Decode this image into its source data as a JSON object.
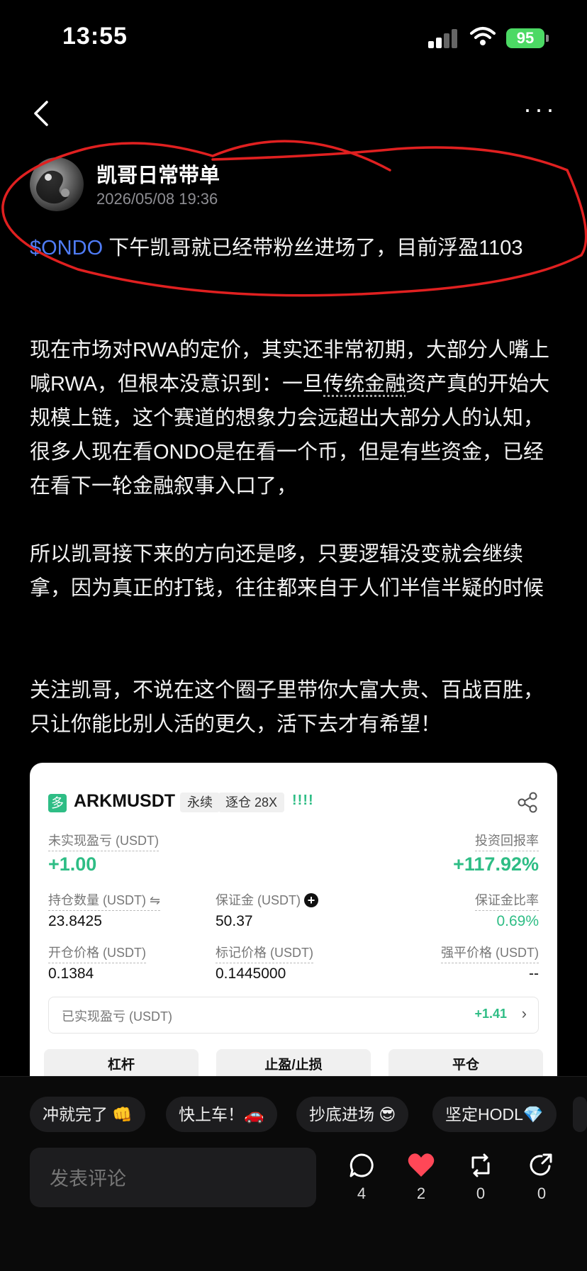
{
  "status_bar": {
    "time": "13:55",
    "battery": "95"
  },
  "post": {
    "author": "凯哥日常带单",
    "date": "2026/05/08 19:36",
    "ticker": "$ONDO",
    "first_line": " 下午凯哥就已经带粉丝进场了，目前浮盈1103",
    "para1_a": "现在市场对RWA的定价，其实还非常初期，大部分人嘴上喊RWA，但根本没意识到：一旦",
    "para1_u": "传统金融",
    "para1_b": "资产真的开始大规模上链，这个赛道的想象力会远超出大部分人的认知，很多人现在看ONDO是在看一个币，但是有些资金，已经在看下一轮金融叙事入口了，",
    "para2": "所以凯哥接下来的方向还是哆，只要逻辑没变就会继续拿，因为真正的打钱，往往都来自于人们半信半疑的时候",
    "para3": "关注凯哥，不说在这个圈子里带你大富大贵、百战百胜，只让你能比别人活的更久，活下去才有希望！"
  },
  "card": {
    "badge": "多",
    "symbol": "ARKMUSDT",
    "tag1": "永续",
    "tag2": "逐仓 28X",
    "bars": "!!!!",
    "unrealized_label": "未实现盈亏 (USDT)",
    "unrealized_value": "+1.00",
    "roi_label": "投资回报率",
    "roi_value": "+117.92%",
    "qty_label": "持仓数量 (USDT) ⇋",
    "qty_value": "23.8425",
    "margin_label": "保证金 (USDT)",
    "margin_value": "50.37",
    "margin_ratio_label": "保证金比率",
    "margin_ratio_value": "0.69%",
    "open_price_label": "开仓价格 (USDT)",
    "open_price_value": "0.1384",
    "mark_price_label": "标记价格 (USDT)",
    "mark_price_value": "0.1445000",
    "liq_price_label": "强平价格 (USDT)",
    "liq_price_value": "--",
    "realized_label": "已实现盈亏 (USDT)",
    "realized_value": "+1.41",
    "buttons": [
      "杠杆",
      "止盈/止损",
      "平仓"
    ]
  },
  "chips": [
    "冲就完了 👊",
    "快上车！🚗",
    "抄底进场 😎",
    "坚定HODL💎"
  ],
  "comment_placeholder": "发表评论",
  "actions": {
    "comments": "4",
    "likes": "2",
    "reposts": "0",
    "shares": "0"
  },
  "colors": {
    "accent_blue": "#4f7cf7",
    "green": "#2ebd85",
    "like_red": "#ff4757",
    "annotation_red": "#e02020"
  }
}
